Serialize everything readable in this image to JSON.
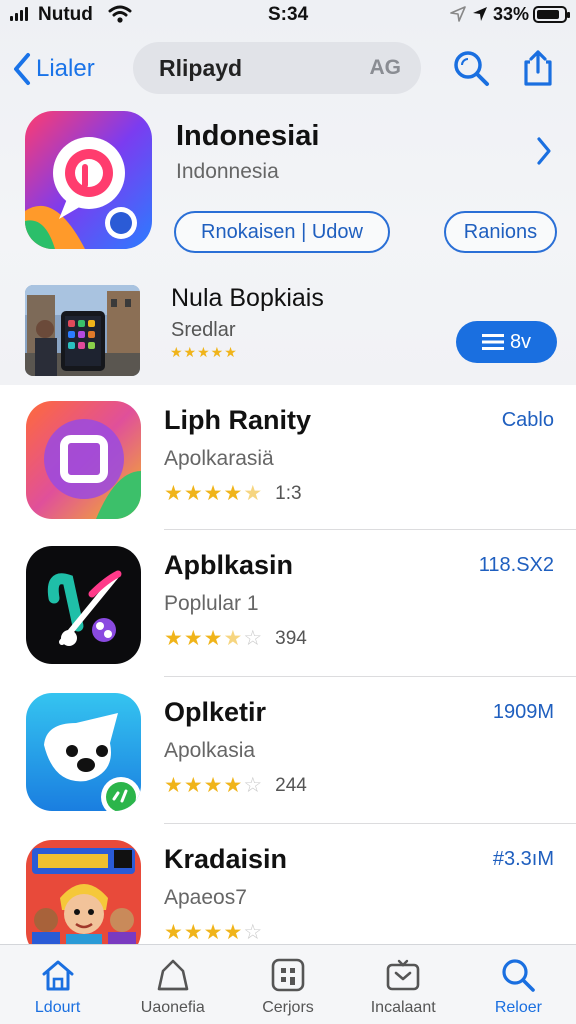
{
  "status_bar": {
    "carrier": "Nutud",
    "time": "S:34",
    "battery_text": "33%",
    "battery_level": 0.85
  },
  "nav": {
    "back_label": "Lialer",
    "search_query": "Rlipayd",
    "search_badge": "AG"
  },
  "featured": {
    "title": "Indonesiai",
    "subtitle": "Indonnesia",
    "button_left": "Rnokaisen | Udow",
    "button_right": "Ranions"
  },
  "featured2": {
    "title": "Nula Bopkiais",
    "subtitle": "Sredlar",
    "stars": "★★★★★",
    "get_label": "8v"
  },
  "apps": [
    {
      "name": "Liph Ranity",
      "category": "Apolkarasiä",
      "rating_stars": 4.5,
      "count": "1:3",
      "action": "Cablo"
    },
    {
      "name": "Apblkasin",
      "category": "Poplular 1",
      "rating_stars": 3.5,
      "count": "394",
      "action": "118.SX2"
    },
    {
      "name": "Oplketir",
      "category": "Apolkasia",
      "rating_stars": 4,
      "count": "244",
      "action": "1909M"
    },
    {
      "name": "Kradaisin",
      "category": "Apaeos7",
      "rating_stars": 4,
      "count": "",
      "action": "#3.3ıM"
    }
  ],
  "tabs": [
    {
      "label": "Ldourt",
      "icon": "home-icon",
      "active": true
    },
    {
      "label": "Uaonefia",
      "icon": "games-icon",
      "active": false
    },
    {
      "label": "Cerjors",
      "icon": "apps-icon",
      "active": false
    },
    {
      "label": "Incalaant",
      "icon": "updates-icon",
      "active": false
    },
    {
      "label": "Reloer",
      "icon": "search-icon",
      "active": true
    }
  ],
  "colors": {
    "accent": "#1a6fe0",
    "star": "#f0b41a"
  }
}
